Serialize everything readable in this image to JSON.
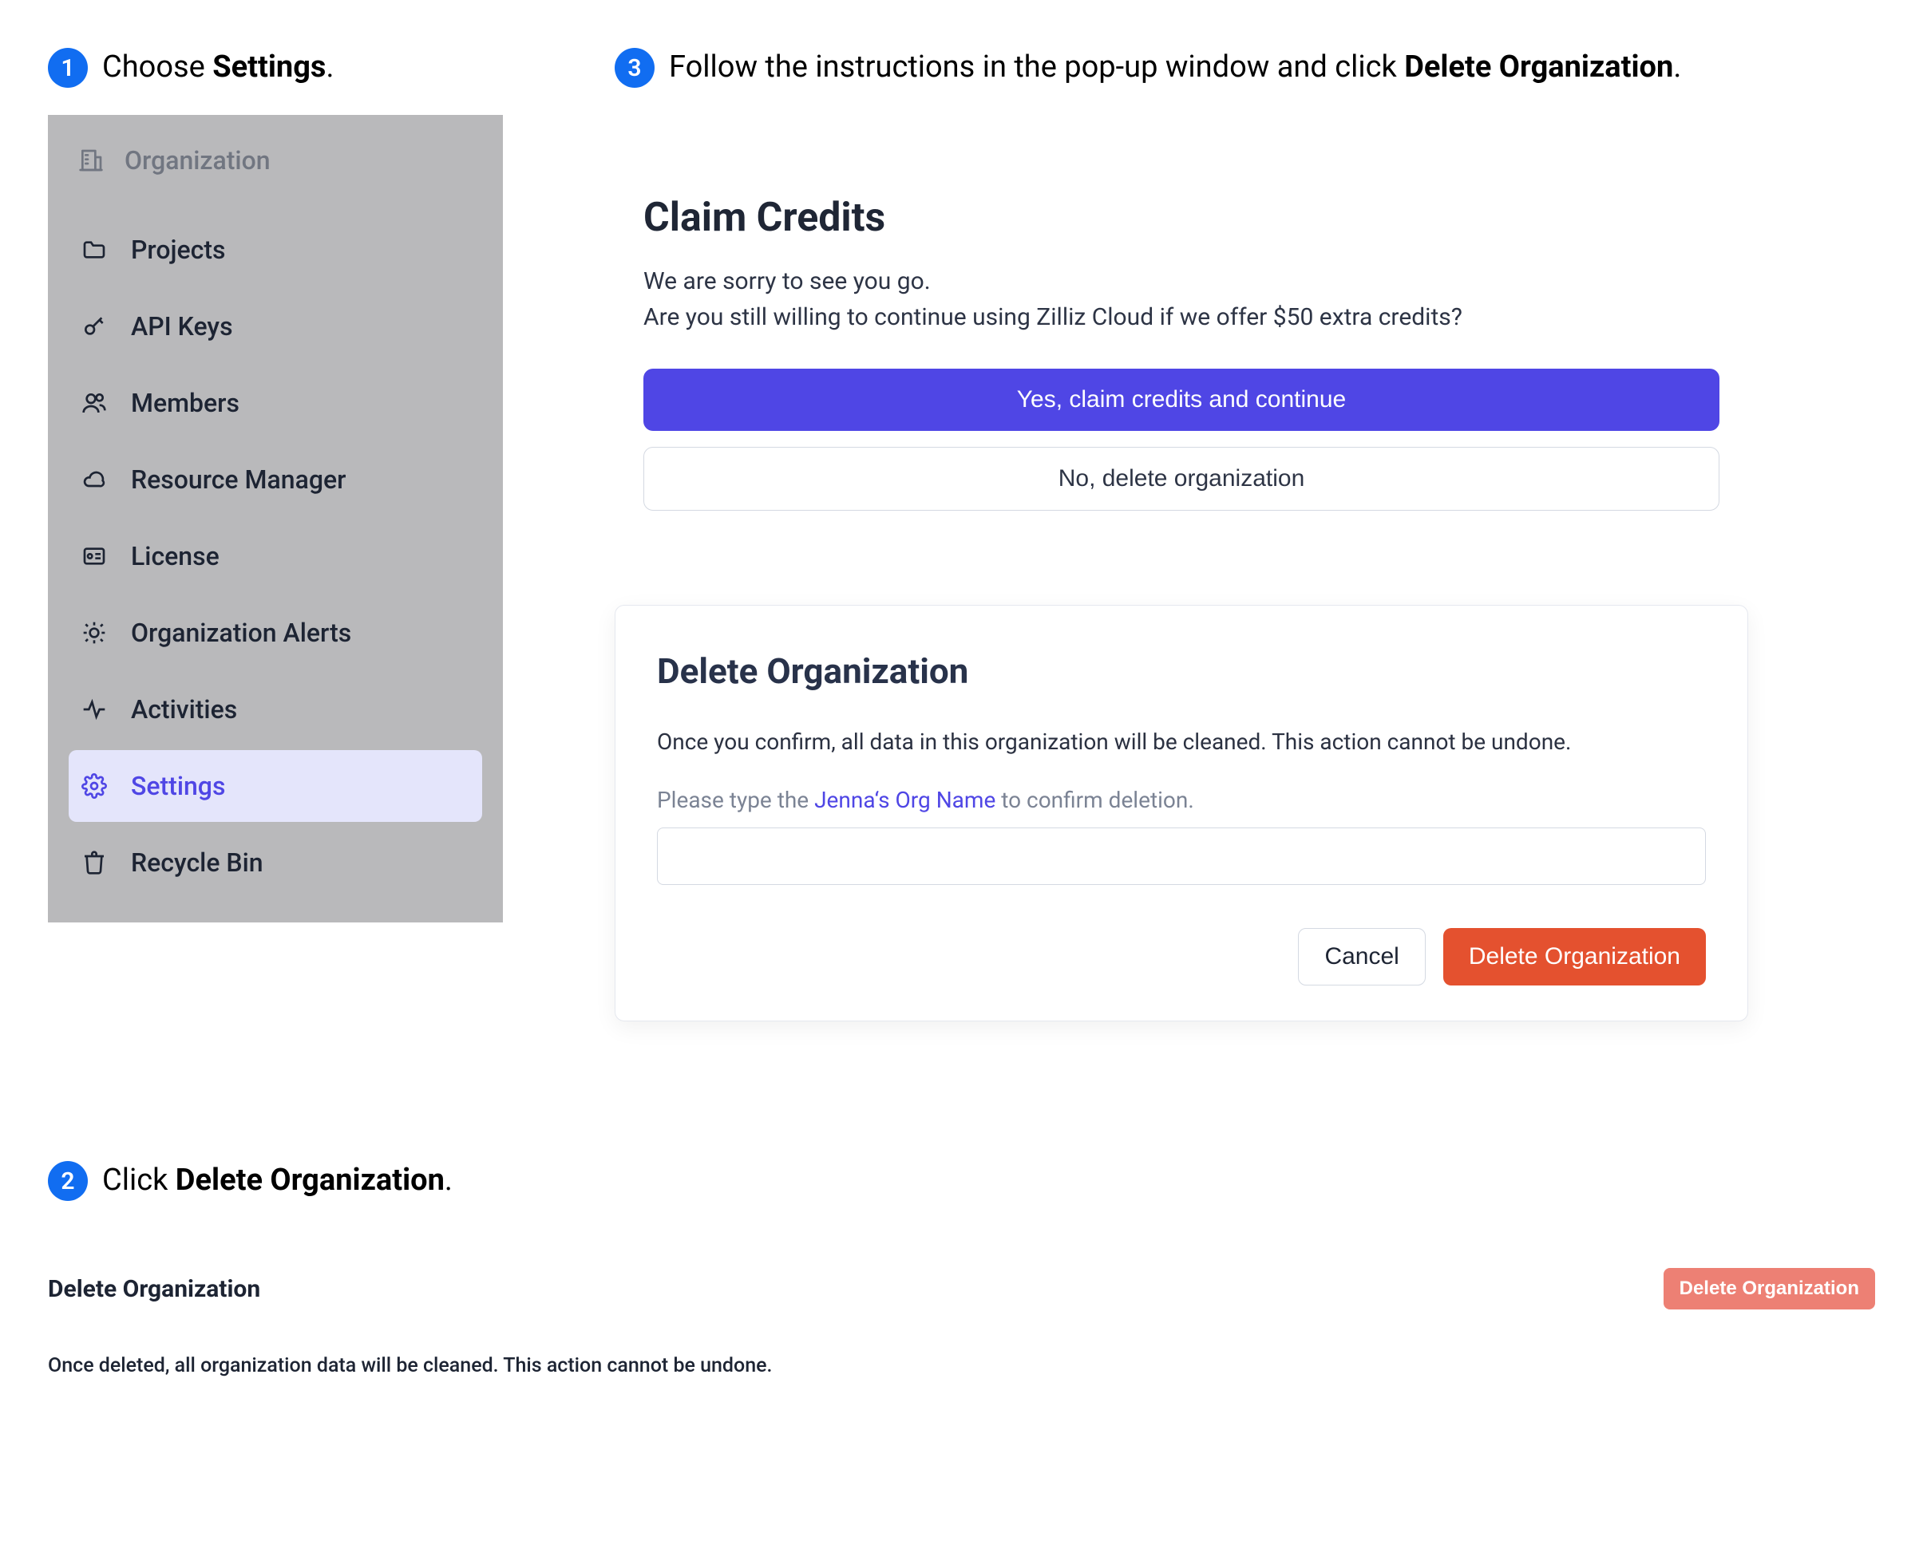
{
  "steps": {
    "s1_prefix": "Choose ",
    "s1_bold": "Settings",
    "s1_suffix": ".",
    "s2_prefix": "Click ",
    "s2_bold": "Delete Organization",
    "s2_suffix": ".",
    "s3_prefix": "Follow the instructions in the pop-up window and click ",
    "s3_bold": "Delete Organization",
    "s3_suffix": "."
  },
  "sidebar": {
    "header": "Organization",
    "items": [
      {
        "label": "Projects"
      },
      {
        "label": "API Keys"
      },
      {
        "label": "Members"
      },
      {
        "label": "Resource Manager"
      },
      {
        "label": "License"
      },
      {
        "label": "Organization Alerts"
      },
      {
        "label": "Activities"
      },
      {
        "label": "Settings"
      },
      {
        "label": "Recycle Bin"
      }
    ]
  },
  "claim": {
    "title": "Claim Credits",
    "line1": "We are sorry to see you go.",
    "line2": "Are you still willing to continue using Zilliz Cloud if we offer $50 extra credits?",
    "btn_yes": "Yes, claim credits and continue",
    "btn_no": "No, delete organization"
  },
  "deleteModal": {
    "title": "Delete Organization",
    "desc": "Once you confirm, all data in this organization will be cleaned. This action cannot be undone.",
    "prompt_before": "Please type the ",
    "org_name": "Jenna‘s Org Name",
    "prompt_after": " to confirm deletion.",
    "cancel": "Cancel",
    "delete": "Delete Organization"
  },
  "dangerZone": {
    "title": "Delete Organization",
    "button": "Delete Organization",
    "note": "Once deleted, all organization data will be cleaned. This action cannot be undone."
  }
}
